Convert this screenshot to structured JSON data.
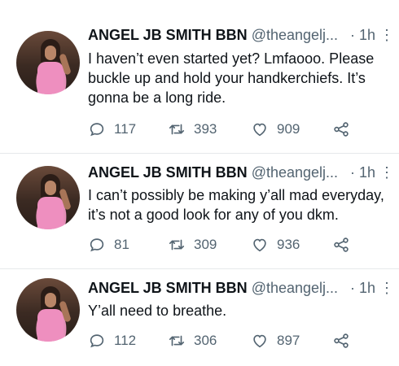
{
  "tweets": [
    {
      "display_name": "ANGEL JB SMITH BBN",
      "handle": "@theangelj...",
      "time": "· 1h",
      "text": "I haven’t even started yet? Lmfaooo. Please buckle up and hold your handkerchiefs. It’s gonna be a long ride.",
      "replies": "117",
      "retweets": "393",
      "likes": "909"
    },
    {
      "display_name": "ANGEL JB SMITH BBN",
      "handle": "@theangelj...",
      "time": "· 1h",
      "text": "I can’t possibly be making y’all mad everyday, it’s not a good look for any of you dkm.",
      "replies": "81",
      "retweets": "309",
      "likes": "936"
    },
    {
      "display_name": "ANGEL JB SMITH BBN",
      "handle": "@theangelj...",
      "time": "· 1h",
      "text": "Y’all need to breathe.",
      "replies": "112",
      "retweets": "306",
      "likes": "897"
    }
  ],
  "icons": {
    "reply": "comment-icon",
    "retweet": "retweet-icon",
    "like": "heart-icon",
    "share": "share-icon",
    "more": "more-options-icon"
  },
  "more_glyph": "⋮",
  "colors": {
    "text": "#0f1419",
    "secondary": "#536471",
    "divider": "#e6e9eb"
  }
}
